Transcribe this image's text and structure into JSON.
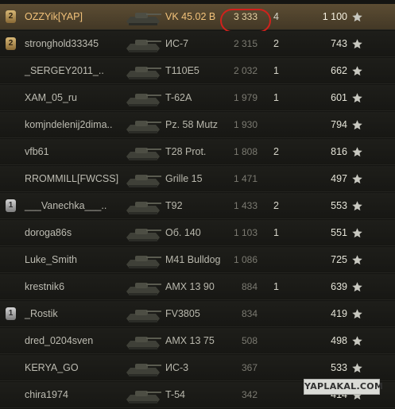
{
  "accent": {
    "highlight_text": "#f2c27a",
    "ring": "#d1211c"
  },
  "rows": [
    {
      "player": "OZZYik[YAP]",
      "vehicle": "VK 45.02 B",
      "damage": "3 333",
      "kills": "4",
      "xp": "1 100",
      "badge": "2",
      "badge_style": "gold",
      "highlight": true,
      "circled": true
    },
    {
      "player": "stronghold33345",
      "vehicle": "ИС-7",
      "damage": "2 315",
      "kills": "2",
      "xp": "743",
      "badge": "2",
      "badge_style": "gold",
      "highlight": false,
      "circled": false
    },
    {
      "player": "_SERGEY2011_..",
      "vehicle": "T110E5",
      "damage": "2 032",
      "kills": "1",
      "xp": "662",
      "badge": "",
      "badge_style": "",
      "highlight": false,
      "circled": false
    },
    {
      "player": "XAM_05_ru",
      "vehicle": "T-62A",
      "damage": "1 979",
      "kills": "1",
      "xp": "601",
      "badge": "",
      "badge_style": "",
      "highlight": false,
      "circled": false
    },
    {
      "player": "komjndelenij2dima..",
      "vehicle": "Pz. 58 Mutz",
      "damage": "1 930",
      "kills": "",
      "xp": "794",
      "badge": "",
      "badge_style": "",
      "highlight": false,
      "circled": false
    },
    {
      "player": "vfb61",
      "vehicle": "T28 Prot.",
      "damage": "1 808",
      "kills": "2",
      "xp": "816",
      "badge": "",
      "badge_style": "",
      "highlight": false,
      "circled": false
    },
    {
      "player": "RROMMILL[FWCSS]",
      "vehicle": "Grille 15",
      "damage": "1 471",
      "kills": "",
      "xp": "497",
      "badge": "",
      "badge_style": "",
      "highlight": false,
      "circled": false
    },
    {
      "player": "___Vanechka___..",
      "vehicle": "T92",
      "damage": "1 433",
      "kills": "2",
      "xp": "553",
      "badge": "1",
      "badge_style": "silver",
      "highlight": false,
      "circled": false
    },
    {
      "player": "doroga86s",
      "vehicle": "Об. 140",
      "damage": "1 103",
      "kills": "1",
      "xp": "551",
      "badge": "",
      "badge_style": "",
      "highlight": false,
      "circled": false
    },
    {
      "player": "Luke_Smith",
      "vehicle": "M41 Bulldog",
      "damage": "1 086",
      "kills": "",
      "xp": "725",
      "badge": "",
      "badge_style": "",
      "highlight": false,
      "circled": false
    },
    {
      "player": "krestnik6",
      "vehicle": "AMX 13 90",
      "damage": "884",
      "kills": "1",
      "xp": "639",
      "badge": "",
      "badge_style": "",
      "highlight": false,
      "circled": false
    },
    {
      "player": "_Rostik",
      "vehicle": "FV3805",
      "damage": "834",
      "kills": "",
      "xp": "419",
      "badge": "1",
      "badge_style": "silver",
      "highlight": false,
      "circled": false
    },
    {
      "player": "dred_0204sven",
      "vehicle": "AMX 13 75",
      "damage": "508",
      "kills": "",
      "xp": "498",
      "badge": "",
      "badge_style": "",
      "highlight": false,
      "circled": false
    },
    {
      "player": "KERYA_GO",
      "vehicle": "ИС-3",
      "damage": "367",
      "kills": "",
      "xp": "533",
      "badge": "",
      "badge_style": "",
      "highlight": false,
      "circled": false
    },
    {
      "player": "chira1974",
      "vehicle": "T-54",
      "damage": "342",
      "kills": "",
      "xp": "414",
      "badge": "",
      "badge_style": "",
      "highlight": false,
      "circled": false
    }
  ],
  "watermark": "YAPLAKAL.COM"
}
